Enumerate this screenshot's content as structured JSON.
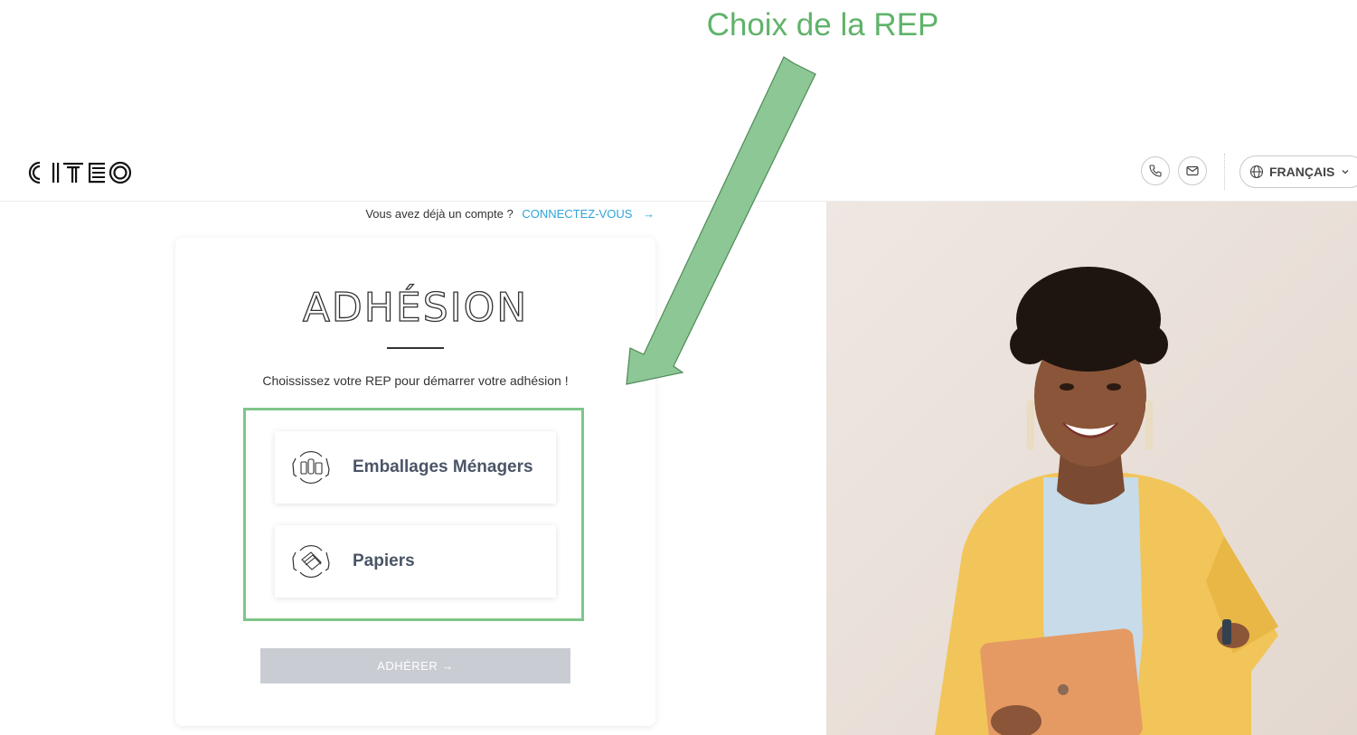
{
  "annotation": {
    "title": "Choix de la REP",
    "color": "#5fb36a"
  },
  "header": {
    "logo_text": "CITEO",
    "icons": [
      "phone-icon",
      "mail-icon",
      "globe-icon",
      "chevron-down-icon"
    ],
    "language_label": "FRANÇAIS"
  },
  "account": {
    "question": "Vous avez déjà un compte ?",
    "link_label": "CONNECTEZ-VOUS",
    "arrow": "→"
  },
  "card": {
    "title": "ADHÉSION",
    "subtitle": "Choississez votre REP pour démarrer votre adhésion !",
    "options": [
      {
        "label": "Emballages Ménagers",
        "icon": "household-packaging-icon"
      },
      {
        "label": "Papiers",
        "icon": "papers-icon"
      }
    ],
    "submit_label": "ADHÉRER →"
  },
  "colors": {
    "link": "#2ea4d9",
    "highlight_box": "#7fc58a",
    "submit_disabled": "#c9ccd3",
    "option_text": "#4a5566"
  }
}
